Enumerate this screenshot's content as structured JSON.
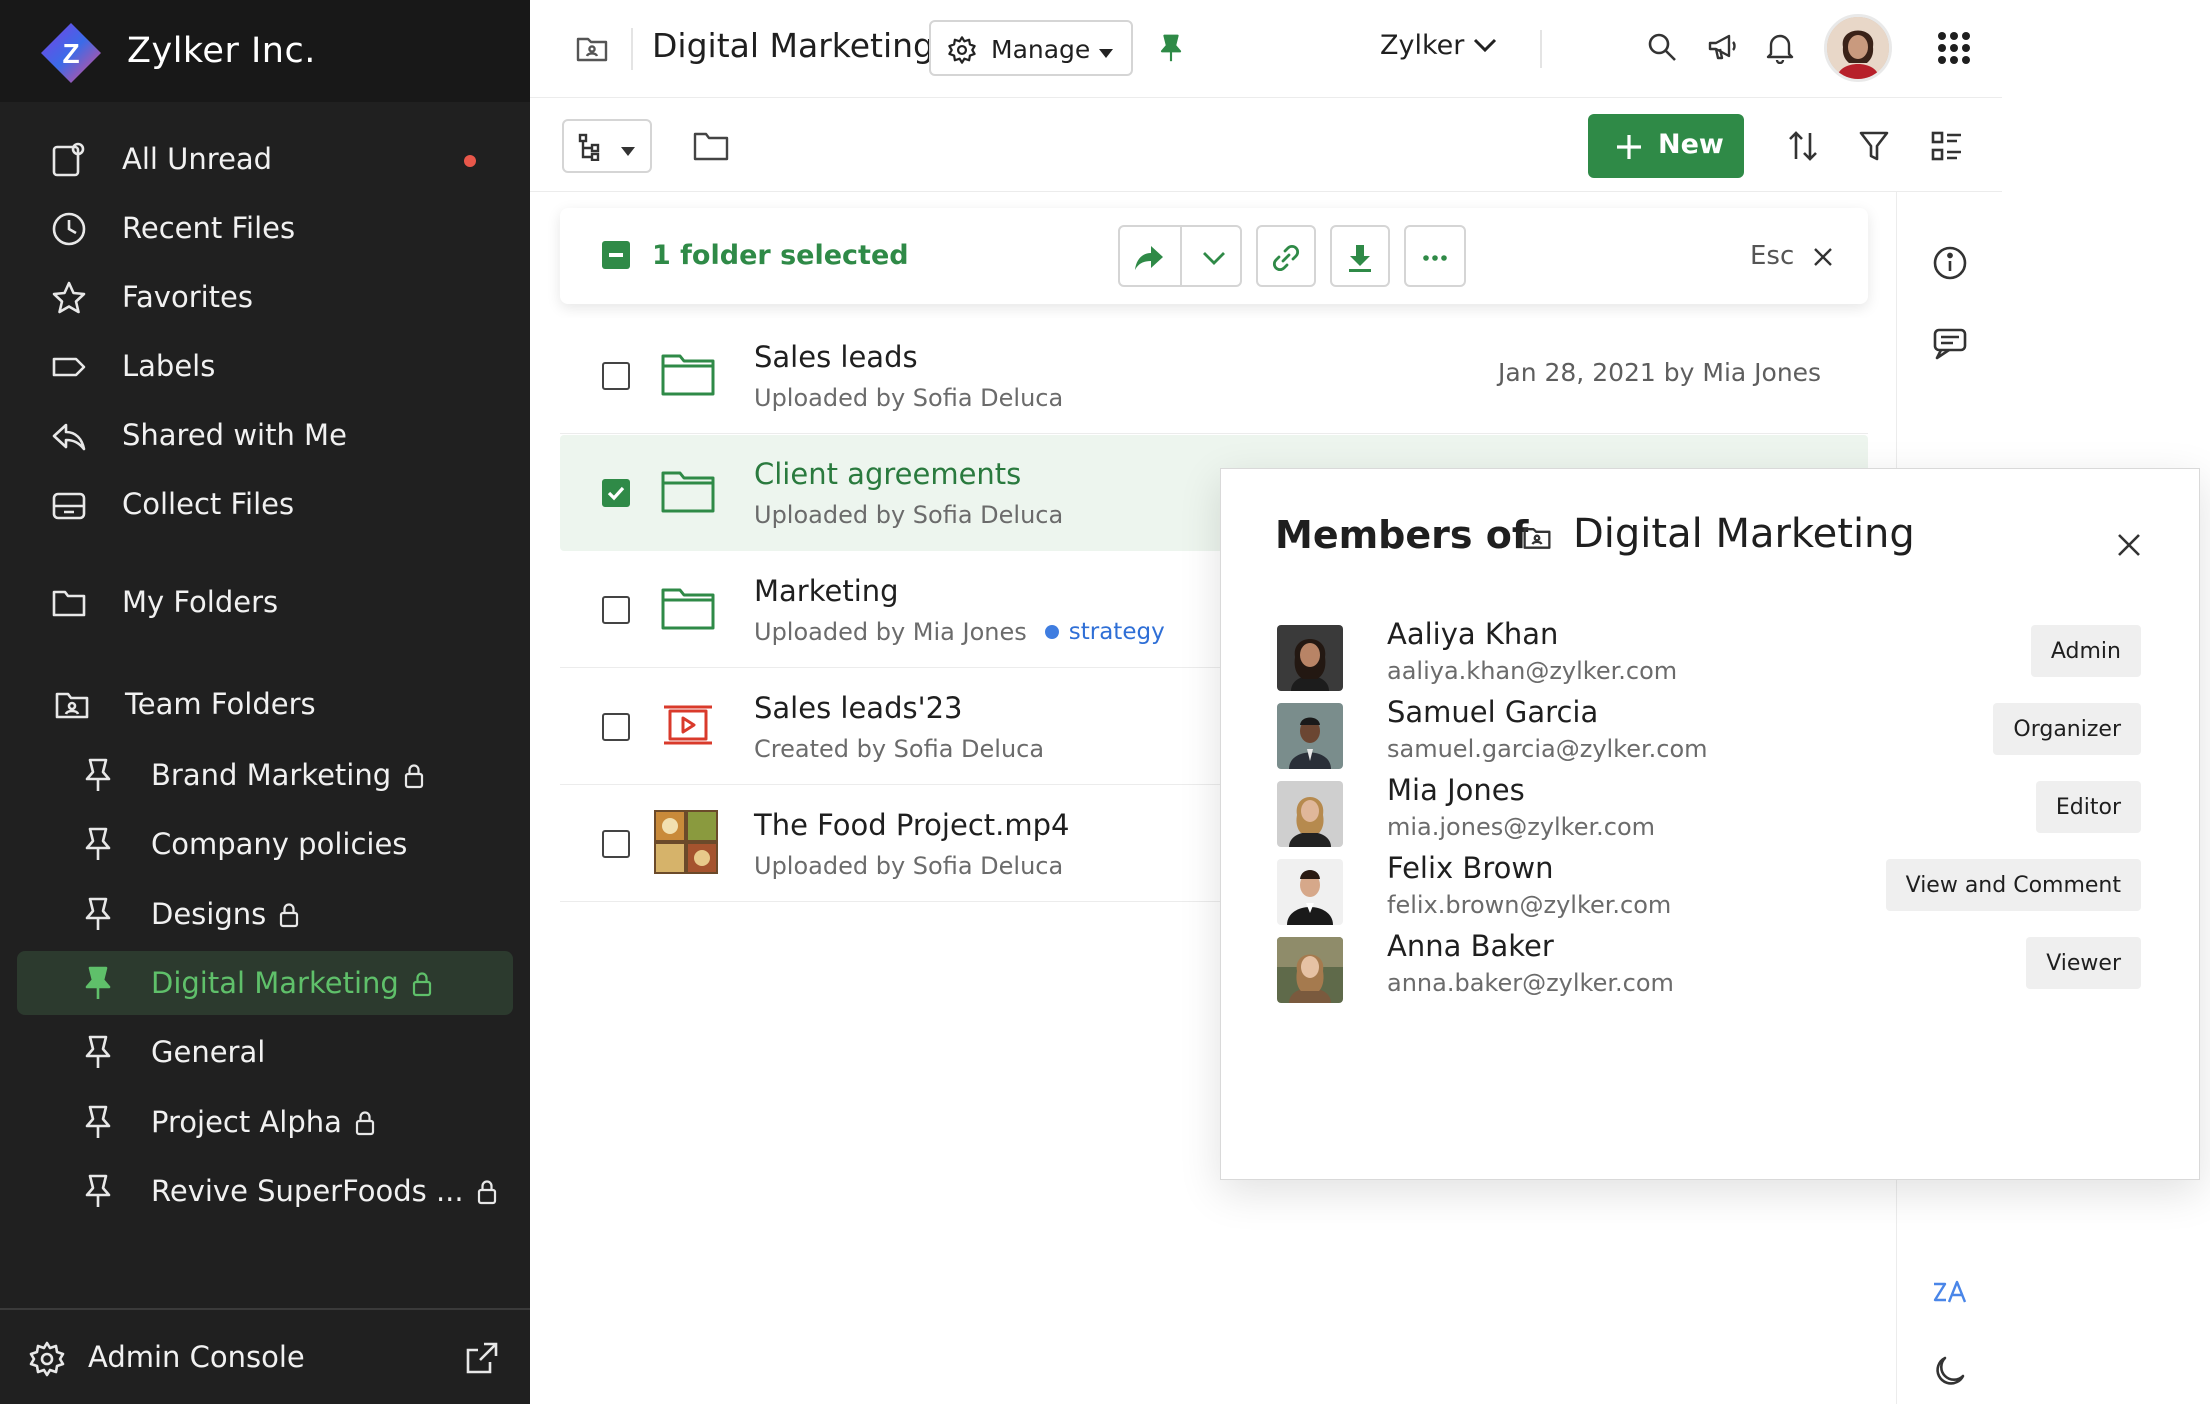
{
  "sidebar": {
    "brand": "Zylker Inc.",
    "brand_logo_letter": "Z",
    "nav": [
      {
        "label": "All Unread",
        "icon": "unread-icon",
        "dot": true
      },
      {
        "label": "Recent Files",
        "icon": "clock-icon"
      },
      {
        "label": "Favorites",
        "icon": "star-icon"
      },
      {
        "label": "Labels",
        "icon": "label-icon"
      },
      {
        "label": "Shared with Me",
        "icon": "shared-icon"
      },
      {
        "label": "Collect Files",
        "icon": "collect-icon"
      }
    ],
    "my_folders": "My Folders",
    "team_folders": "Team Folders",
    "teams": [
      {
        "label": "Brand Marketing",
        "locked": true
      },
      {
        "label": "Company policies",
        "locked": false
      },
      {
        "label": "Designs",
        "locked": true
      },
      {
        "label": "Digital Marketing",
        "locked": true,
        "active": true
      },
      {
        "label": "General",
        "locked": false
      },
      {
        "label": "Project Alpha",
        "locked": true
      },
      {
        "label": "Revive SuperFoods ...",
        "locked": true
      }
    ],
    "footer": {
      "label": "Admin Console"
    }
  },
  "header": {
    "title": "Digital Marketing",
    "manage_label": "Manage",
    "org": "Zylker"
  },
  "toolbar": {
    "new_label": "New"
  },
  "selection": {
    "text": "1 folder selected",
    "esc": "Esc"
  },
  "files": [
    {
      "name": "Sales leads",
      "sub": "Uploaded by Sofia Deluca",
      "meta": "Jan 28, 2021 by Mia Jones",
      "type": "folder",
      "checked": false
    },
    {
      "name": "Client agreements",
      "sub": "Uploaded by Sofia Deluca",
      "meta": "",
      "type": "folder",
      "checked": true
    },
    {
      "name": "Marketing",
      "sub": "Uploaded by Mia Jones",
      "tag": "strategy",
      "meta": "",
      "type": "folder",
      "checked": false
    },
    {
      "name": "Sales leads'23",
      "sub": "Created by Sofia Deluca",
      "meta": "",
      "type": "presentation",
      "checked": false
    },
    {
      "name": "The Food Project.mp4",
      "sub": "Uploaded by Sofia Deluca",
      "meta": "",
      "type": "video",
      "checked": false
    }
  ],
  "members_panel": {
    "title": "Members of",
    "folder": "Digital Marketing",
    "members": [
      {
        "name": "Aaliya Khan",
        "email": "aaliya.khan@zylker.com",
        "role": "Admin"
      },
      {
        "name": "Samuel Garcia",
        "email": "samuel.garcia@zylker.com",
        "role": "Organizer"
      },
      {
        "name": "Mia Jones",
        "email": "mia.jones@zylker.com",
        "role": "Editor"
      },
      {
        "name": "Felix Brown",
        "email": "felix.brown@zylker.com",
        "role": "View and Comment"
      },
      {
        "name": "Anna Baker",
        "email": "anna.baker@zylker.com",
        "role": "Viewer"
      }
    ]
  },
  "colors": {
    "sidebar_bg": "#202020",
    "accent_green": "#2f8a47",
    "active_team_text": "#5fc06a",
    "unread_dot": "#e8574a",
    "tag_blue": "#2f6fd6"
  }
}
